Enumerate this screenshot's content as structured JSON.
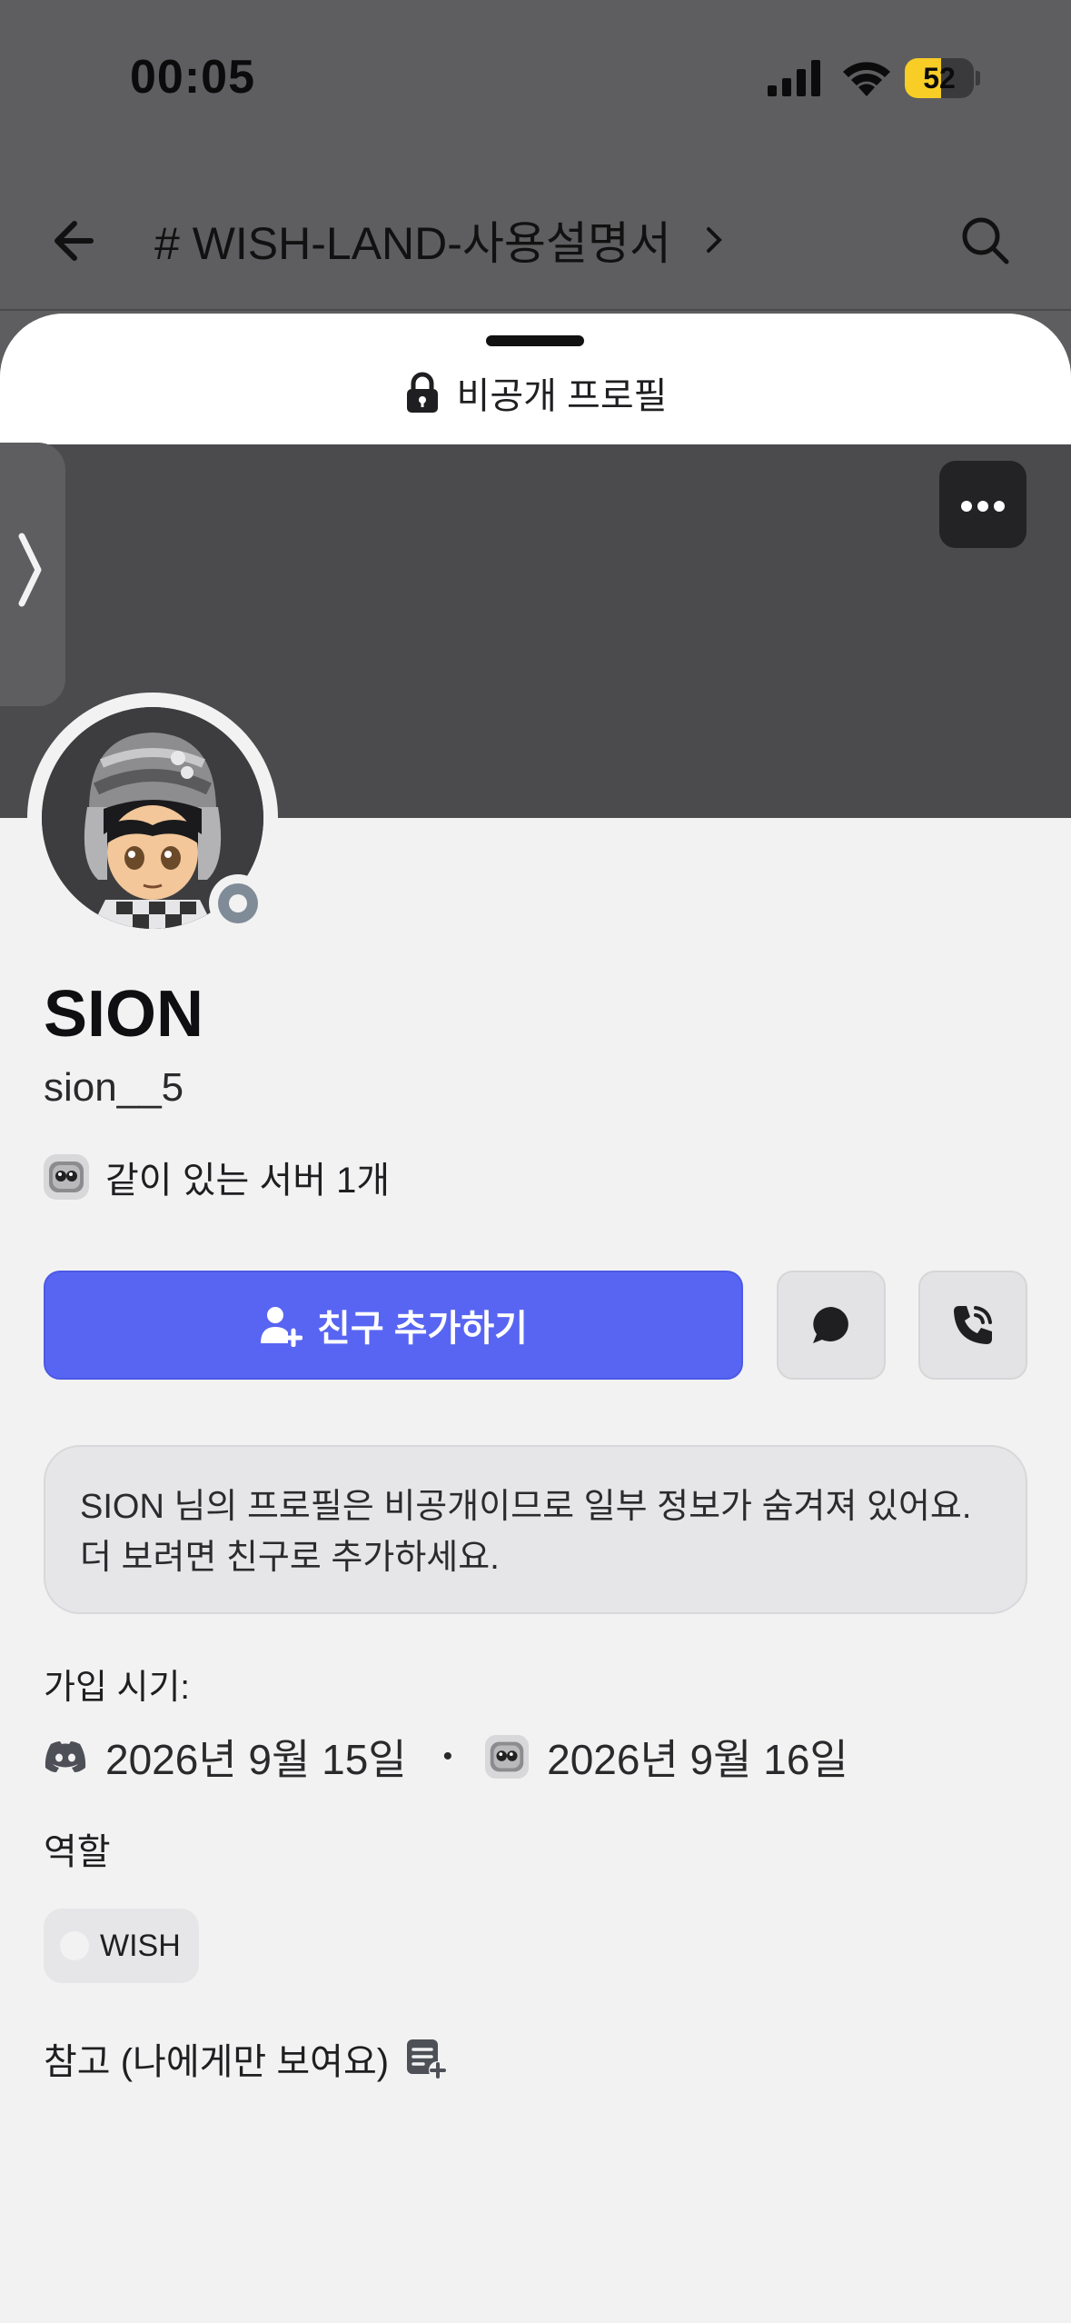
{
  "status_bar": {
    "time": "00:05",
    "battery_percent": "52",
    "battery_level": 0.52
  },
  "channel_header": {
    "title": "# WISH-LAND-사용설명서"
  },
  "profile": {
    "private_label": "비공개 프로필",
    "display_name": "SION",
    "username": "sion__5",
    "mutual_servers": "같이 있는 서버 1개",
    "add_friend_label": "친구 추가하기",
    "notice_line1": "SION 님의 프로필은 비공개이므로 일부 정보가 숨겨져 있어요.",
    "notice_line2": "더 보려면 친구로 추가하세요.",
    "joined_title": "가입 시기:",
    "discord_joined": "2026년 9월 15일",
    "bullet": "•",
    "server_joined": "2026년 9월 16일",
    "roles_title": "역할",
    "roles": [
      "WISH"
    ],
    "note_label": "참고 (나에게만 보여요)"
  },
  "colors": {
    "accent": "#5865f2",
    "battery": "#f7cd26",
    "banner": "#4b4b4d",
    "status_offline": "#7f8b96"
  },
  "icons": [
    "back-arrow-icon",
    "search-icon",
    "lock-icon",
    "more-icon",
    "chevron-right-icon",
    "add-friend-icon",
    "message-icon",
    "call-icon",
    "discord-icon",
    "note-add-icon"
  ]
}
